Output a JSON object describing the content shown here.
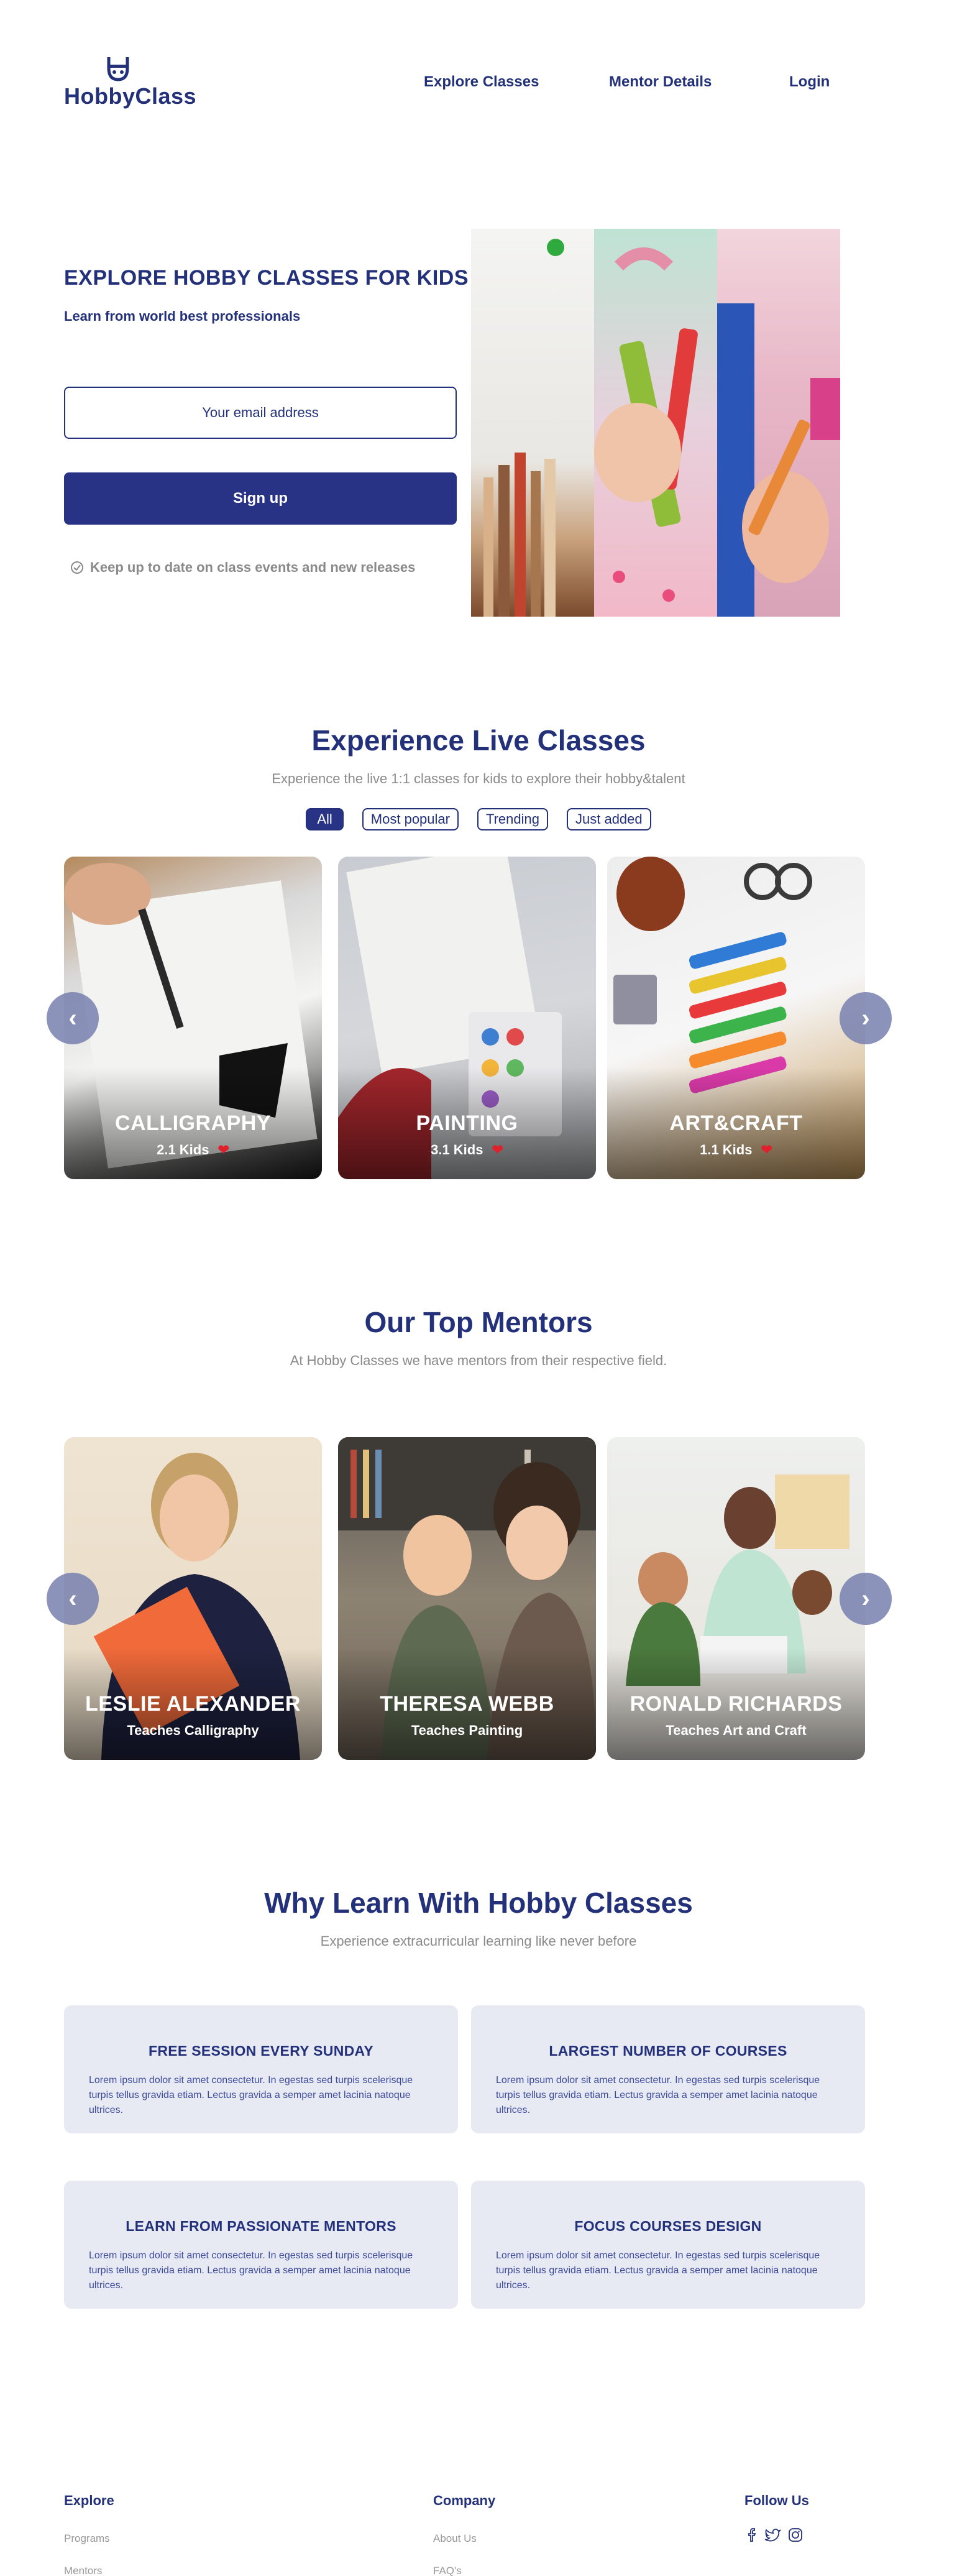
{
  "header": {
    "logo_text": "HobbyClass",
    "nav": [
      "Explore Classes",
      "Mentor Details",
      "Login"
    ]
  },
  "hero": {
    "title": "EXPLORE HOBBY CLASSES FOR KIDS",
    "subtitle": "Learn from world best professionals",
    "email_placeholder": "Your email address",
    "signup_label": "Sign up",
    "note": "Keep up to date on class  events and new releases"
  },
  "live": {
    "title": "Experience Live Classes",
    "subtitle": "Experience the live 1:1 classes for kids to explore  their hobby&talent",
    "filters": [
      "All",
      "Most popular",
      "Trending",
      "Just added"
    ],
    "active_filter": "All",
    "cards": [
      {
        "title": "CALLIGRAPHY",
        "kids": "2.1 Kids"
      },
      {
        "title": "PAINTING",
        "kids": "3.1 Kids"
      },
      {
        "title": "ART&CRAFT",
        "kids": "1.1 Kids"
      }
    ]
  },
  "mentors": {
    "title": "Our Top Mentors",
    "subtitle": "At Hobby Classes we have mentors from their respective field.",
    "cards": [
      {
        "name": "LESLIE ALEXANDER",
        "teaches": "Teaches Calligraphy"
      },
      {
        "name": "THERESA WEBB",
        "teaches": "Teaches Painting"
      },
      {
        "name": "RONALD RICHARDS",
        "teaches": "Teaches Art and Craft"
      }
    ]
  },
  "why": {
    "title": "Why Learn With Hobby Classes",
    "subtitle": "Experience extracurricular  learning like never before",
    "items": [
      {
        "title": "FREE SESSION EVERY SUNDAY",
        "text": "Lorem ipsum dolor sit amet consectetur. In egestas sed turpis scelerisque turpis tellus gravida etiam. Lectus gravida a semper amet lacinia natoque ultrices."
      },
      {
        "title": "LARGEST NUMBER OF COURSES",
        "text": "Lorem ipsum dolor sit amet consectetur. In egestas sed turpis scelerisque turpis tellus gravida etiam. Lectus gravida a semper amet lacinia natoque ultrices."
      },
      {
        "title": "LEARN FROM PASSIONATE MENTORS",
        "text": "Lorem ipsum dolor sit amet consectetur. In egestas sed turpis scelerisque turpis tellus gravida etiam. Lectus gravida a semper amet lacinia natoque ultrices."
      },
      {
        "title": "FOCUS COURSES DESIGN",
        "text": "Lorem ipsum dolor sit amet consectetur. In egestas sed turpis scelerisque turpis tellus gravida etiam. Lectus gravida a semper amet lacinia natoque ultrices."
      }
    ]
  },
  "footer": {
    "explore": {
      "heading": "Explore",
      "links": [
        "Programs",
        "Mentors"
      ]
    },
    "company": {
      "heading": "Company",
      "links": [
        "About Us",
        "FAQ's"
      ]
    },
    "follow": {
      "heading": "Follow  Us",
      "icons": [
        "facebook-icon",
        "twitter-icon",
        "instagram-icon"
      ]
    }
  },
  "colors": {
    "brand": "#23307a",
    "button": "#283385",
    "card_bg": "#e8eaf3",
    "heart": "#e0202a"
  }
}
